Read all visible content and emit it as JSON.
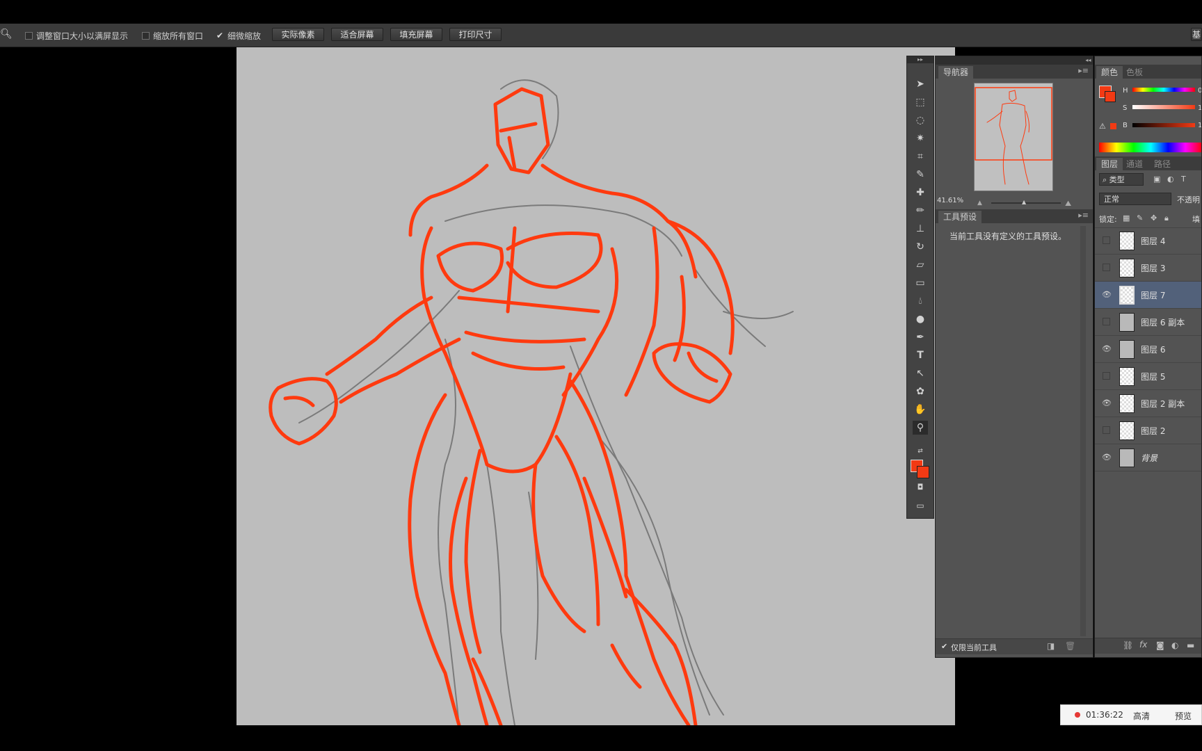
{
  "options_bar": {
    "check_resize": {
      "label": "调整窗口大小以满屏显示",
      "checked": false
    },
    "check_zoom_all": {
      "label": "缩放所有窗口",
      "checked": false
    },
    "check_scrubby": {
      "label": "细微缩放",
      "checked": true
    },
    "btn_actual": "实际像素",
    "btn_fit": "适合屏幕",
    "btn_fill": "填充屏幕",
    "btn_print": "打印尺寸",
    "btn_right_partial": "基"
  },
  "navigator": {
    "tab": "导航器",
    "zoom": "41.61%"
  },
  "tool_presets": {
    "tab": "工具预设",
    "message": "当前工具没有定义的工具预设。",
    "current_only": "仅限当前工具"
  },
  "color_panel": {
    "tab_active": "颜色",
    "tab_inactive": "色板",
    "h_label": "H",
    "s_label": "S",
    "b_label": "B",
    "h_value_partial": "0",
    "s_value_partial": "1",
    "b_value_partial": "1",
    "foreground": "#f23a14",
    "background": "#f23a14"
  },
  "layers_panel": {
    "tab_active": "图层",
    "tab_channels": "通道",
    "tab_paths": "路径",
    "filter_kind": "类型",
    "blend_mode": "正常",
    "opacity_label_partial": "不透明",
    "lock_label": "锁定:",
    "fill_partial": "填",
    "layers": [
      {
        "name": "图层 4",
        "visible": false,
        "selected": false,
        "thumb": "checker"
      },
      {
        "name": "图层 3",
        "visible": false,
        "selected": false,
        "thumb": "checker"
      },
      {
        "name": "图层 7",
        "visible": true,
        "selected": true,
        "thumb": "checker"
      },
      {
        "name": "图层 6 副本",
        "visible": false,
        "selected": false,
        "thumb": "gray"
      },
      {
        "name": "图层 6",
        "visible": true,
        "selected": false,
        "thumb": "gray"
      },
      {
        "name": "图层 5",
        "visible": false,
        "selected": false,
        "thumb": "checker"
      },
      {
        "name": "图层 2 副本",
        "visible": true,
        "selected": false,
        "thumb": "checker"
      },
      {
        "name": "图层 2",
        "visible": false,
        "selected": false,
        "thumb": "checker"
      },
      {
        "name": "背景",
        "visible": true,
        "selected": false,
        "thumb": "gray"
      }
    ]
  },
  "player": {
    "time": "01:36:22",
    "quality": "高清",
    "preview": "预览"
  },
  "colors": {
    "accent_red": "#f23a14",
    "panel_bg": "#535353",
    "selected_layer": "#52617a"
  }
}
